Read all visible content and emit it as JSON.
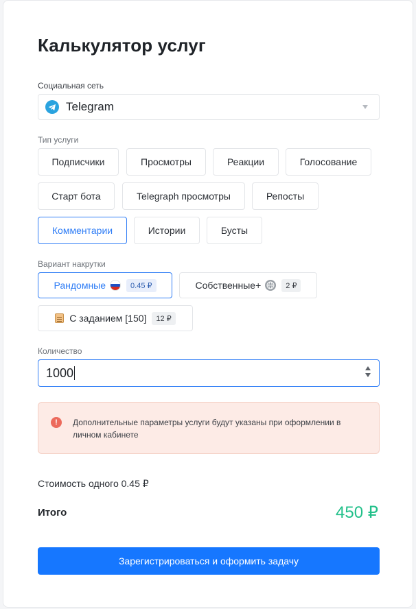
{
  "page": {
    "title": "Калькулятор услуг"
  },
  "network": {
    "label": "Социальная сеть",
    "selected": "Telegram",
    "icon": "telegram-icon"
  },
  "service": {
    "label": "Тип услуги",
    "options": [
      "Подписчики",
      "Просмотры",
      "Реакции",
      "Голосование",
      "Старт бота",
      "Telegraph просмотры",
      "Репосты",
      "Комментарии",
      "Истории",
      "Бусты"
    ],
    "selected": "Комментарии"
  },
  "variant": {
    "label": "Вариант накрутки",
    "options": [
      {
        "label": "Рандомные",
        "price": "0.45 ₽",
        "icon": "russia-flag-icon"
      },
      {
        "label": "Собственные+",
        "price": "2 ₽",
        "icon": "globe-icon"
      },
      {
        "label": "С заданием [150]",
        "price": "12 ₽",
        "icon": "clipboard-icon"
      }
    ],
    "selected": "Рандомные"
  },
  "quantity": {
    "label": "Количество",
    "value": "1000"
  },
  "alert": {
    "text": "Дополнительные параметры услуги будут указаны при оформлении в личном кабинете",
    "icon": "info-icon"
  },
  "pricing": {
    "unit_cost": "Стоимость одного 0.45 ₽",
    "total_label": "Итого",
    "total_value": "450 ₽"
  },
  "submit_label": "Зарегистрироваться и оформить задачу",
  "colors": {
    "accent": "#1677ff",
    "active_border": "#2f7df6",
    "total": "#22c08a",
    "alert_bg": "#fdebe6",
    "alert_icon": "#ec6a5c",
    "telegram": "#2aa3df"
  }
}
